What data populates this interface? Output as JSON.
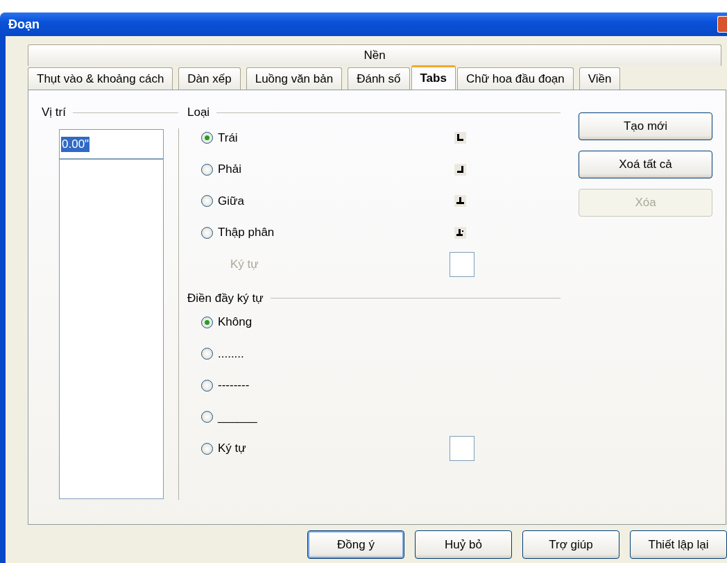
{
  "window": {
    "title": "Đoạn"
  },
  "tabs_back_row": [
    {
      "label": "Nền",
      "selected": false
    }
  ],
  "tabs": [
    {
      "label": "Thụt vào & khoảng cách",
      "selected": false
    },
    {
      "label": "Dàn xếp",
      "selected": false
    },
    {
      "label": "Luồng văn bản",
      "selected": false
    },
    {
      "label": "Đánh số",
      "selected": false
    },
    {
      "label": "Tabs",
      "selected": true
    },
    {
      "label": "Chữ hoa đầu đoạn",
      "selected": false
    },
    {
      "label": "Viền",
      "selected": false
    }
  ],
  "position": {
    "label": "Vị trí",
    "value": "0.00\"",
    "value_selected": true
  },
  "type": {
    "label": "Loại",
    "options": [
      {
        "label": "Trái",
        "selected": true,
        "kind": "left"
      },
      {
        "label": "Phải",
        "selected": false,
        "kind": "right"
      },
      {
        "label": "Giữa",
        "selected": false,
        "kind": "center"
      },
      {
        "label": "Thập phân",
        "selected": false,
        "kind": "decimal"
      }
    ],
    "character": {
      "label": "Ký tự",
      "disabled": true
    }
  },
  "fill": {
    "label": "Điền đầy ký tự",
    "options": [
      {
        "label": "Không",
        "selected": true,
        "kind": "plain"
      },
      {
        "label": "........",
        "selected": false,
        "kind": "plain"
      },
      {
        "label": "--------",
        "selected": false,
        "kind": "plain"
      },
      {
        "label": "______",
        "selected": false,
        "kind": "plain"
      },
      {
        "label": "Ký tự",
        "selected": false,
        "kind": "character"
      }
    ]
  },
  "side_buttons": [
    {
      "label": "Tạo mới",
      "disabled": false
    },
    {
      "label": "Xoá tất cả",
      "disabled": false
    },
    {
      "label": "Xóa",
      "disabled": true
    }
  ],
  "footer_buttons": [
    {
      "label": "Đồng ý",
      "default": true
    },
    {
      "label": "Huỷ bỏ",
      "default": false
    },
    {
      "label": "Trợ giúp",
      "default": false
    },
    {
      "label": "Thiết lập lại",
      "default": false
    }
  ]
}
